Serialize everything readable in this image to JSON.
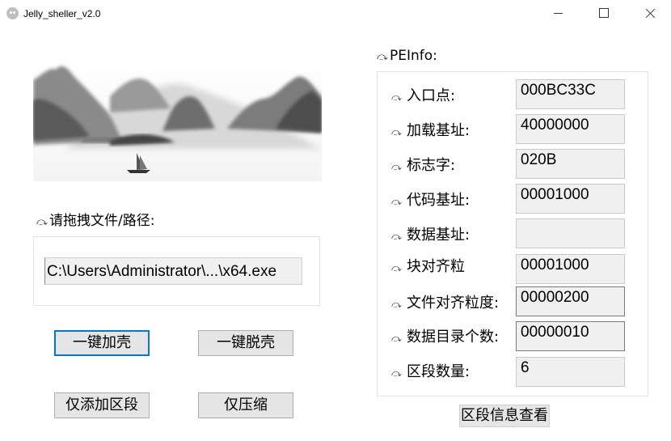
{
  "window": {
    "title": "Jelly_sheller_v2.0",
    "minimize_icon": "minimize-icon",
    "maximize_icon": "maximize-icon",
    "close_icon": "close-icon"
  },
  "left": {
    "drop_label": "请拖拽文件/路径:",
    "file_path": "C:\\Users\\Administrator\\...\\x64.exe",
    "buttons": {
      "pack": "一键加壳",
      "unpack": "一键脱壳",
      "add_section": "仅添加区段",
      "compress": "仅压缩"
    }
  },
  "peinfo": {
    "title": "PEInfo:",
    "fields": [
      {
        "label": "入口点:",
        "value": "000BC33C"
      },
      {
        "label": "加载基址:",
        "value": "40000000"
      },
      {
        "label": "标志字:",
        "value": "020B"
      },
      {
        "label": "代码基址:",
        "value": "00001000"
      },
      {
        "label": "数据基址:",
        "value": ""
      },
      {
        "label": "块对齐粒",
        "value": "00001000"
      },
      {
        "label": "文件对齐粒度:",
        "value": "00000200"
      },
      {
        "label": "数据目录个数:",
        "value": "00000010"
      },
      {
        "label": "区段数量:",
        "value": "6"
      }
    ],
    "view_sections_button": "区段信息查看"
  },
  "colors": {
    "focus_border": "#0078d7",
    "button_face": "#e5e5e5",
    "field_bg": "#f0f0f0"
  }
}
